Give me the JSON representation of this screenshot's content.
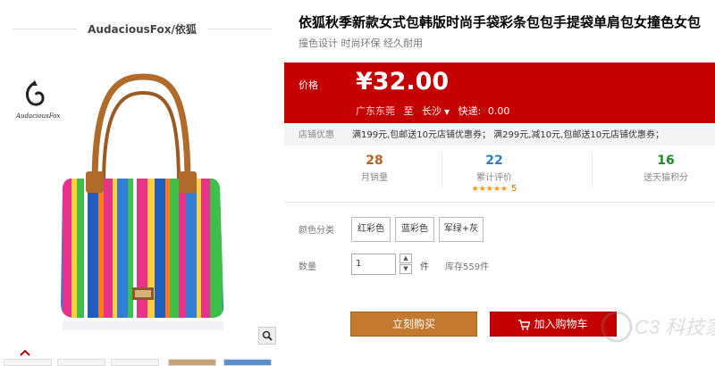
{
  "shop": {
    "name": "AudaciousFox/依狐",
    "logo_text": "AudaciousFox"
  },
  "product": {
    "title": "依狐秋季新款女式包韩版时尚手袋彩条包包手提袋单肩包女撞色女包",
    "subtitle": "撞色设计 时尚环保 经久耐用"
  },
  "price": {
    "label": "价格",
    "value": "¥32.00",
    "ship_from": "广东东莞",
    "ship_to_word": "至",
    "destination": "长沙",
    "shipping_label": "快递:",
    "shipping_fee": "0.00"
  },
  "promo": {
    "label": "店铺优惠",
    "text": "满199元,包邮送10元店铺优惠券；  满299元,减10元,包邮送10元店铺优惠券；"
  },
  "stats": [
    {
      "value": "28",
      "label": "月销量",
      "color": "#b5622a"
    },
    {
      "value": "22",
      "label": "累计评价",
      "color": "#2a7fc6",
      "stars": "★★★★★",
      "score": "5"
    },
    {
      "value": "16",
      "label": "送天猫积分",
      "color": "#1e8a2a"
    }
  ],
  "colors": {
    "label": "颜色分类",
    "options": [
      "红彩色",
      "蓝彩色",
      "军绿+灰"
    ]
  },
  "quantity": {
    "label": "数量",
    "value": "1",
    "unit": "件",
    "stock": "库存559件"
  },
  "actions": {
    "buy_label": "立刻购买",
    "cart_label": "加入购物车"
  },
  "watermark": "C3 科技家",
  "theme": {
    "accent": "#c40000",
    "buy_color": "#c37a2e"
  }
}
